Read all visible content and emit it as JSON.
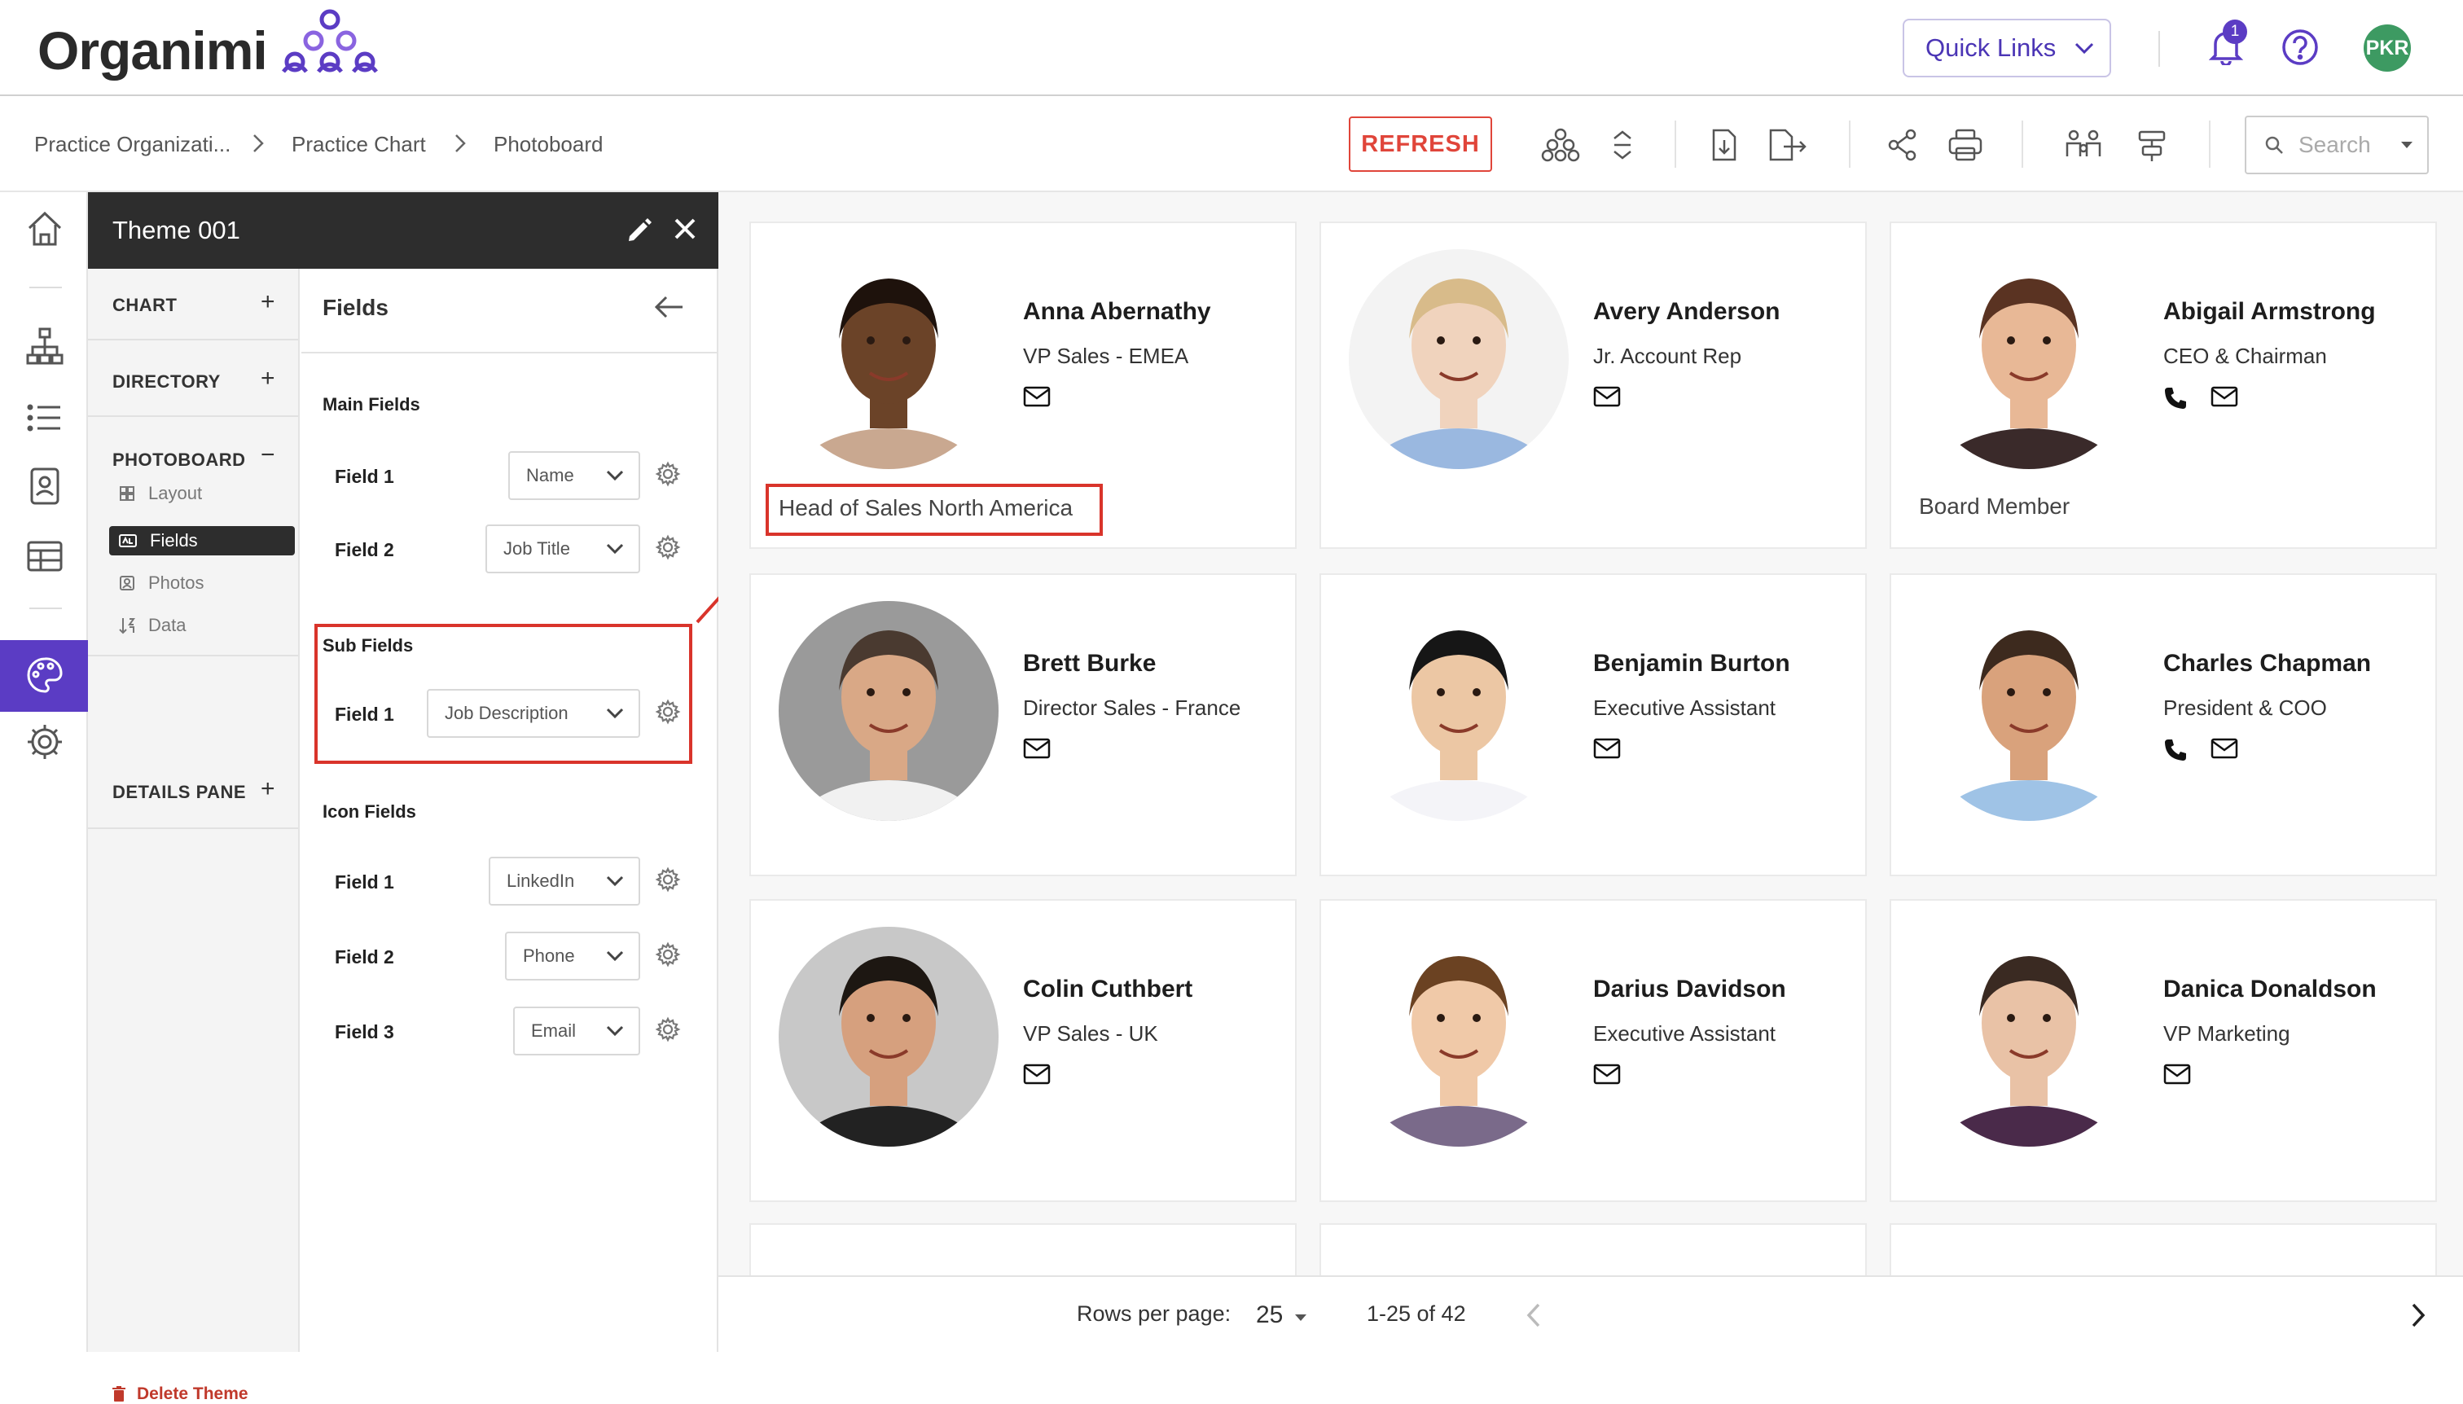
{
  "app": {
    "logo_text": "Organimi"
  },
  "topbar": {
    "quick_links": "Quick Links",
    "notification_count": "1",
    "avatar_initials": "PKR"
  },
  "breadcrumb": [
    "Practice Organizati...",
    "Practice Chart",
    "Photoboard"
  ],
  "toolbar": {
    "refresh_label": "REFRESH",
    "search_placeholder": "Search"
  },
  "theme_panel": {
    "title": "Theme 001",
    "sections": {
      "chart": "CHART",
      "directory": "DIRECTORY",
      "photoboard": "PHOTOBOARD",
      "details_pane": "DETAILS PANE"
    },
    "photoboard_items": [
      "Layout",
      "Fields",
      "Photos",
      "Data"
    ],
    "active_item": "Fields",
    "delete_label": "Delete Theme"
  },
  "fields_panel": {
    "title": "Fields",
    "main_fields_label": "Main Fields",
    "main_fields": [
      {
        "label": "Field 1",
        "value": "Name"
      },
      {
        "label": "Field 2",
        "value": "Job Title"
      }
    ],
    "sub_fields_label": "Sub Fields",
    "sub_fields": [
      {
        "label": "Field 1",
        "value": "Job Description"
      }
    ],
    "icon_fields_label": "Icon Fields",
    "icon_fields": [
      {
        "label": "Field 1",
        "value": "LinkedIn"
      },
      {
        "label": "Field 2",
        "value": "Phone"
      },
      {
        "label": "Field 3",
        "value": "Email"
      }
    ]
  },
  "people": [
    {
      "name": "Anna Abernathy",
      "title": "VP Sales - EMEA",
      "sub": "Head of Sales North America",
      "phone": false,
      "skin": "#6b4328",
      "hair": "#1e120c",
      "shirt": "#c9a890",
      "bg": "#ffffff"
    },
    {
      "name": "Avery Anderson",
      "title": "Jr. Account Rep",
      "sub": "",
      "phone": false,
      "skin": "#f0d3bd",
      "hair": "#d8bb8a",
      "shirt": "#9ab8e0",
      "bg": "#f3f3f3"
    },
    {
      "name": "Abigail Armstrong",
      "title": "CEO & Chairman",
      "sub": "Board Member",
      "phone": true,
      "skin": "#e8b896",
      "hair": "#5a3322",
      "shirt": "#3a2a2a",
      "bg": "#ffffff"
    },
    {
      "name": "Brett Burke",
      "title": "Director Sales - France",
      "sub": "",
      "phone": false,
      "skin": "#d9a886",
      "hair": "#4a3a30",
      "shirt": "#f1f1f1",
      "bg": "#9a9a9a"
    },
    {
      "name": "Benjamin Burton",
      "title": "Executive Assistant",
      "sub": "",
      "phone": false,
      "skin": "#ecc7a4",
      "hair": "#161616",
      "shirt": "#f4f4f8",
      "bg": "#ffffff"
    },
    {
      "name": "Charles Chapman",
      "title": "President & COO",
      "sub": "",
      "phone": true,
      "skin": "#d9a27c",
      "hair": "#3d2a1e",
      "shirt": "#9fc3e6",
      "bg": "#ffffff"
    },
    {
      "name": "Colin Cuthbert",
      "title": "VP Sales - UK",
      "sub": "",
      "phone": false,
      "skin": "#d6a07e",
      "hair": "#1d1712",
      "shirt": "#222222",
      "bg": "#c8c8c8"
    },
    {
      "name": "Darius Davidson",
      "title": "Executive Assistant",
      "sub": "",
      "phone": false,
      "skin": "#f0c9a8",
      "hair": "#6b4222",
      "shirt": "#7a6a8a",
      "bg": "#ffffff"
    },
    {
      "name": "Danica Donaldson",
      "title": "VP Marketing",
      "sub": "",
      "phone": false,
      "skin": "#e9c2a6",
      "hair": "#3a2a22",
      "shirt": "#4a2a4a",
      "bg": "#ffffff"
    }
  ],
  "footer": {
    "rows_label": "Rows per page:",
    "rows_value": "25",
    "range": "1-25 of 42"
  },
  "colors": {
    "accent": "#5b3cc4",
    "highlight": "#d9342b",
    "refresh": "#e0453a"
  }
}
